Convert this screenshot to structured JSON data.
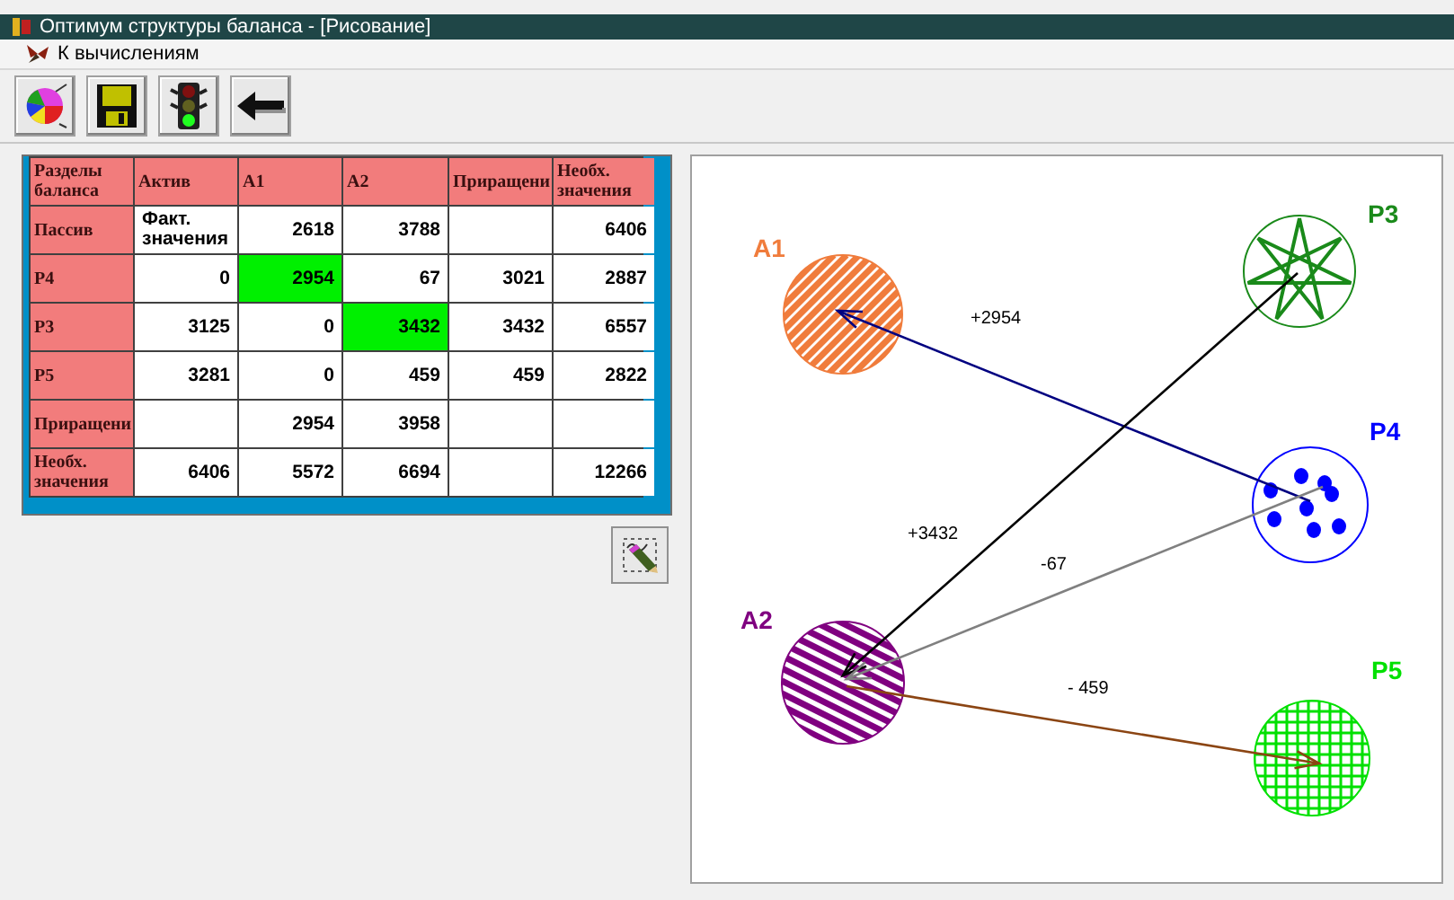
{
  "window": {
    "title": "Оптимум структуры баланса - [Рисование]"
  },
  "menu": [
    {
      "label": "К вычислениям"
    }
  ],
  "table": {
    "columns": [
      "Разделы баланса",
      "Актив",
      "A1",
      "A2",
      "Приращени",
      "Необх. значения"
    ],
    "rows": [
      {
        "cells": [
          {
            "text": "Пассив",
            "highlighted": false
          },
          {
            "text": "Факт. значения",
            "highlighted": false
          },
          {
            "text": "2618",
            "highlighted": false
          },
          {
            "text": "3788",
            "highlighted": false
          },
          {
            "text": "",
            "highlighted": false
          },
          {
            "text": "6406",
            "highlighted": false
          }
        ]
      },
      {
        "cells": [
          {
            "text": "P4",
            "highlighted": false
          },
          {
            "text": "0",
            "highlighted": false
          },
          {
            "text": "2954",
            "highlighted": true
          },
          {
            "text": "67",
            "highlighted": false
          },
          {
            "text": "3021",
            "highlighted": false
          },
          {
            "text": "2887",
            "highlighted": false
          }
        ]
      },
      {
        "cells": [
          {
            "text": "P3",
            "highlighted": false
          },
          {
            "text": "3125",
            "highlighted": false
          },
          {
            "text": "0",
            "highlighted": false
          },
          {
            "text": "3432",
            "highlighted": true
          },
          {
            "text": "3432",
            "highlighted": false
          },
          {
            "text": "6557",
            "highlighted": false
          }
        ]
      },
      {
        "cells": [
          {
            "text": "P5",
            "highlighted": false
          },
          {
            "text": "3281",
            "highlighted": false
          },
          {
            "text": "0",
            "highlighted": false
          },
          {
            "text": "459",
            "highlighted": false
          },
          {
            "text": "459",
            "highlighted": false
          },
          {
            "text": "2822",
            "highlighted": false
          }
        ]
      },
      {
        "cells": [
          {
            "text": "Приращени",
            "highlighted": false
          },
          {
            "text": "",
            "highlighted": false
          },
          {
            "text": "2954",
            "highlighted": false
          },
          {
            "text": "3958",
            "highlighted": false
          },
          {
            "text": "",
            "highlighted": false
          },
          {
            "text": "",
            "highlighted": false
          }
        ]
      },
      {
        "cells": [
          {
            "text": "Необх. значения",
            "highlighted": false
          },
          {
            "text": "6406",
            "highlighted": false
          },
          {
            "text": "5572",
            "highlighted": false
          },
          {
            "text": "6694",
            "highlighted": false
          },
          {
            "text": "",
            "highlighted": false
          },
          {
            "text": "12266",
            "highlighted": false
          }
        ]
      }
    ]
  },
  "diagram": {
    "nodes": [
      {
        "label": "A1",
        "kind": "stripes",
        "color": "#f07c3c"
      },
      {
        "label": "P3",
        "kind": "star",
        "color": "#1a8a1a"
      },
      {
        "label": "P4",
        "kind": "dots",
        "color": "#0000ff"
      },
      {
        "label": "A2",
        "kind": "stripes",
        "color": "#800080"
      },
      {
        "label": "P5",
        "kind": "grid",
        "color": "#00e000"
      }
    ],
    "edges": [
      {
        "label": "+2954",
        "color": "#000080"
      },
      {
        "label": "+3432",
        "color": "#000000"
      },
      {
        "label": "-67",
        "color": "#808080"
      },
      {
        "label": "- 459",
        "color": "#8b4513"
      }
    ]
  }
}
